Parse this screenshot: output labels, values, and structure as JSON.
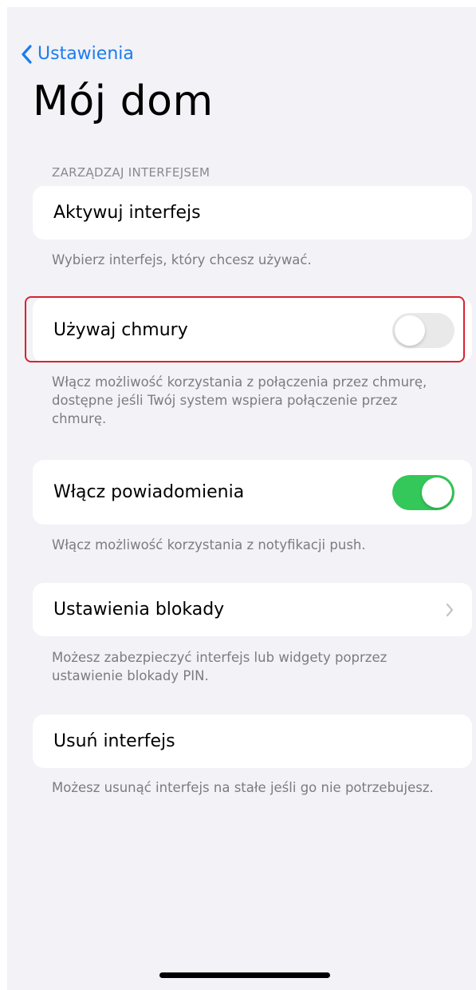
{
  "nav": {
    "back_label": "Ustawienia",
    "title": "Mój dom"
  },
  "section": {
    "header": "ZARZĄDZAJ INTERFEJSEM"
  },
  "items": {
    "activate": {
      "label": "Aktywuj interfejs",
      "footer": "Wybierz interfejs, który chcesz używać."
    },
    "cloud": {
      "label": "Używaj chmury",
      "toggle_on": false,
      "footer": "Włącz możliwość korzystania z połączenia przez chmurę, dostępne jeśli Twój system wspiera połączenie przez chmurę."
    },
    "notifications": {
      "label": "Włącz powiadomienia",
      "toggle_on": true,
      "footer": "Włącz możliwość korzystania z notyfikacji push."
    },
    "lock": {
      "label": "Ustawienia blokady",
      "footer": "Możesz zabezpieczyć interfejs lub widgety poprzez ustawienie blokady PIN."
    },
    "remove": {
      "label": "Usuń interfejs",
      "footer": "Możesz usunąć interfejs na stałe jeśli go nie potrzebujesz."
    }
  },
  "colors": {
    "accent": "#1b7cf2",
    "toggle_on": "#34c759",
    "highlight": "#d9222f",
    "background": "#f2f2f7"
  },
  "icons": {
    "back": "chevron-left-icon",
    "disclosure": "chevron-right-icon"
  }
}
